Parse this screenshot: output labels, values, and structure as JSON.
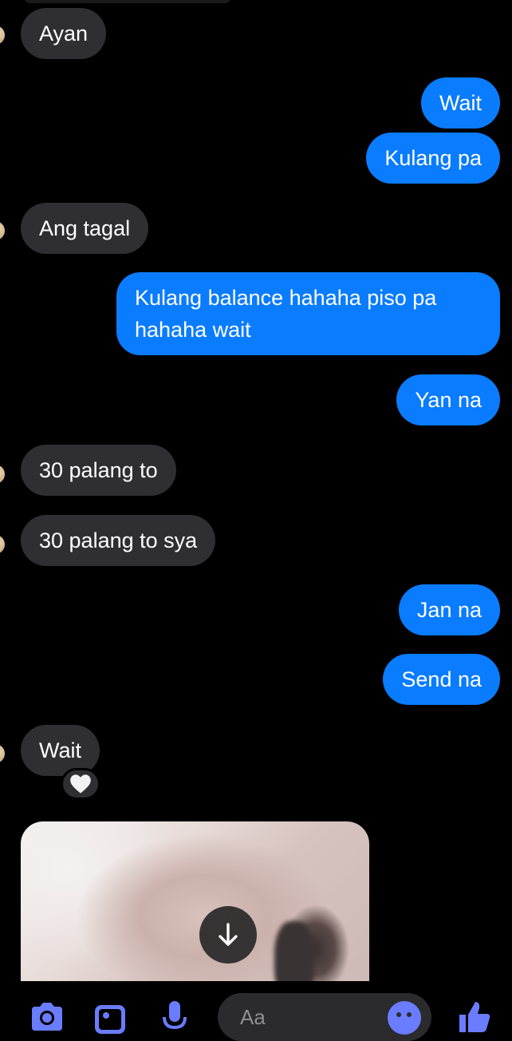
{
  "messages": [
    {
      "side": "in",
      "text": "Ayan"
    },
    {
      "side": "out",
      "text": "Wait"
    },
    {
      "side": "out",
      "text": "Kulang pa"
    },
    {
      "side": "in",
      "text": "Ang tagal"
    },
    {
      "side": "out",
      "text": "Kulang balance hahaha piso pa hahaha wait"
    },
    {
      "side": "out",
      "text": "Yan na"
    },
    {
      "side": "in",
      "text": "30 palang to"
    },
    {
      "side": "in",
      "text": "30 palang to sya"
    },
    {
      "side": "out",
      "text": "Jan na"
    },
    {
      "side": "out",
      "text": "Send na"
    },
    {
      "side": "in",
      "text": "Wait",
      "reaction": "heart-icon"
    }
  ],
  "composer": {
    "placeholder": "Aa"
  },
  "icons": {
    "camera": "camera-icon",
    "gallery": "gallery-icon",
    "mic": "microphone-icon",
    "emoji": "emoji-icon",
    "like": "thumbs-up-icon",
    "download": "download-arrow-icon"
  },
  "colors": {
    "outgoing": "#0a7cff",
    "incoming": "#2f2f31",
    "accent": "#6a7cff",
    "background": "#000000"
  }
}
